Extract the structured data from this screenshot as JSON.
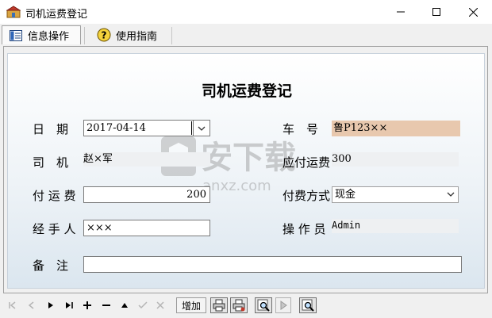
{
  "window": {
    "title": "司机运费登记"
  },
  "tabs": [
    {
      "label": "信息操作",
      "icon": "info-book-icon"
    },
    {
      "label": "使用指南",
      "icon": "help-question-icon"
    }
  ],
  "form": {
    "title": "司机运费登记",
    "date_label": "日　期",
    "date_value": "2017-04-14",
    "driver_label": "司　机",
    "driver_value": "赵×军",
    "freight_label": "付 运 费",
    "freight_value": "200",
    "handler_label": "经 手 人",
    "handler_value": "×××",
    "remark_label": "备　注",
    "remark_value": "",
    "plate_label": "车　号",
    "plate_value": "鲁P123××",
    "plate_bg": "#e8c8ae",
    "payable_label": "应付运费",
    "payable_value": "300",
    "pay_method_label": "付费方式",
    "pay_method_value": "现金",
    "operator_label": "操 作 员",
    "operator_value": "Admin"
  },
  "watermark": {
    "text": "安下载",
    "sub": "anxz.com"
  },
  "toolbar": {
    "add_label": "增加",
    "icons": [
      "first-record-icon",
      "prev-record-icon",
      "next-record-icon",
      "last-record-icon",
      "add-record-icon",
      "delete-record-icon",
      "edit-record-icon",
      "save-record-icon",
      "cancel-record-icon",
      "print-icon",
      "print-preview-icon",
      "search-icon",
      "run-icon",
      "find-icon"
    ]
  }
}
